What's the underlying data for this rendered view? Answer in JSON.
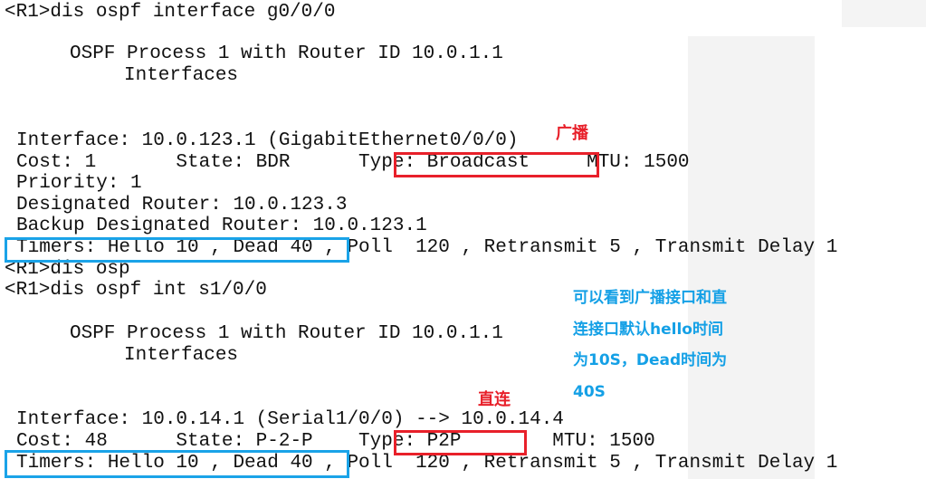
{
  "terminal": {
    "lines": [
      "<R1>dis ospf interface g0/0/0",
      "OSPF Process 1 with Router ID 10.0.1.1",
      "Interfaces",
      "Interface: 10.0.123.1 (GigabitEthernet0/0/0)",
      "Cost: 1       State: BDR      Type: Broadcast     MTU: 1500",
      "Priority: 1",
      "Designated Router: 10.0.123.3",
      "Backup Designated Router: 10.0.123.1",
      "Timers: Hello 10 , Dead 40 , Poll  120 , Retransmit 5 , Transmit Delay 1",
      "<R1>dis osp",
      "<R1>dis ospf int s1/0/0",
      "OSPF Process 1 with Router ID 10.0.1.1",
      "Interfaces",
      "Interface: 10.0.14.1 (Serial1/0/0) --> 10.0.14.4",
      "Cost: 48      State: P-2-P    Type: P2P        MTU: 1500",
      "Timers: Hello 10 , Dead 40 , Poll  120 , Retransmit 5 , Transmit Delay 1"
    ]
  },
  "annotations": {
    "broadcast_label": "广播",
    "p2p_label": "直连",
    "note_lines": [
      "可以看到广播接口和直",
      "连接口默认hello时间",
      "为10S，Dead时间为",
      "40S"
    ],
    "red": "#e8202a",
    "blue": "#1aa3e8"
  }
}
